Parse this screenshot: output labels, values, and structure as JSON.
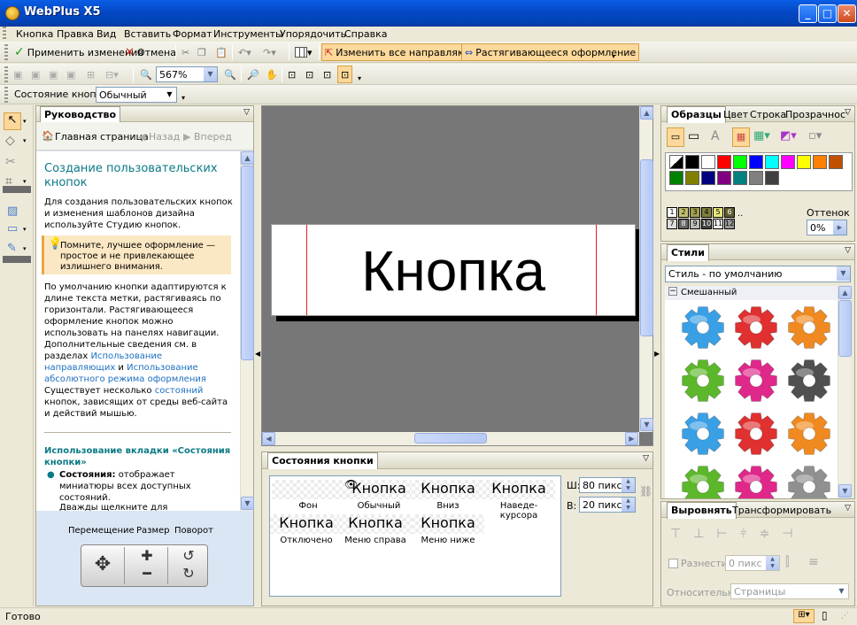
{
  "window": {
    "title": "WebPlus X5"
  },
  "menu": [
    {
      "label": "Кнопка"
    },
    {
      "label": "Правка"
    },
    {
      "label": "Вид"
    },
    {
      "label": "Вставить"
    },
    {
      "label": "Формат"
    },
    {
      "label": "Инструменты"
    },
    {
      "label": "Упорядочить"
    },
    {
      "label": "Справка"
    }
  ],
  "toolbar1": {
    "apply": "Применить изменения",
    "cancel": "Отмена",
    "change_guides": "Изменить все направляющие",
    "stretch": "Растягивающееся оформление"
  },
  "toolbar2": {
    "zoom": "567%"
  },
  "toolbar3": {
    "state_label": "Состояние кнопки:",
    "state_value": "Обычный"
  },
  "guide": {
    "tab": "Руководство",
    "home": "Главная страница",
    "back": "Назад",
    "forward": "Вперед",
    "heading": "Создание пользовательских кнопок",
    "p1": "Для создания пользовательских кнопок и изменения шаблонов дизайна используйте Студию кнопок.",
    "tip": "Помните, лучшее оформление — простое и не привлекающее излишнего внимания.",
    "p2": "По умолчанию кнопки адаптируются к длине текста метки, растягиваясь по горизонтали. Растягивающееся оформление кнопок можно использовать на панелях навигации. Дополнительные сведения см. в разделах",
    "link1": "Использование направляющих",
    "and": "и",
    "link2": "Использование абсолютного режима оформления",
    "p3a": "Существует несколько",
    "p3link": "состояний",
    "p3b": "кнопок, зависящих от среды веб-сайта и действий мышью.",
    "h2": "Использование вкладки «Состояния кнопки»",
    "bullet_b": "Состояния:",
    "bullet": "отображает миниатюры всех доступных состояний.",
    "p4": "Дважды щелкните для",
    "nav_move": "Перемещение",
    "nav_size": "Размер",
    "nav_rotate": "Поворот"
  },
  "canvas": {
    "button_text": "Кнопка"
  },
  "states": {
    "tab": "Состояния кнопки",
    "cells": [
      {
        "text": "",
        "label": "Фон"
      },
      {
        "text": "Кнопка",
        "label": "Обычный"
      },
      {
        "text": "Кнопка",
        "label": "Вниз"
      },
      {
        "text": "Кнопка",
        "label": "Наведе-курсора"
      },
      {
        "text": "Кнопка",
        "label": "Отключено"
      },
      {
        "text": "Кнопка",
        "label": "Меню справа"
      },
      {
        "text": "Кнопка",
        "label": "Меню ниже"
      }
    ],
    "w_label": "Ш:",
    "w_value": "80 пикс",
    "h_label": "В:",
    "h_value": "20 пикс"
  },
  "swatches": {
    "tabs": [
      "Образцы",
      "Цвет",
      "Строка",
      "Прозрачност"
    ],
    "colors": [
      "#ffffff",
      "#000000",
      "#ffffff",
      "#ff0000",
      "#00ff00",
      "#0000ff",
      "#00ffff",
      "#ff00ff",
      "#ffff00",
      "#ff8000",
      "#c05000",
      "#008000",
      "#808000",
      "#000080",
      "#800080",
      "#008080",
      "#808080",
      "#404040"
    ],
    "tint_label": "Оттенок",
    "tint_value": "0%",
    "numbers": [
      "1",
      "2",
      "3",
      "4",
      "5",
      "6",
      "7",
      "8",
      "9",
      "10",
      "11",
      "12"
    ],
    "more": ".."
  },
  "styles": {
    "tab": "Стили",
    "select": "Стиль - по умолчанию",
    "group": "Смешанный",
    "gear_colors": [
      "#3aa0e6",
      "#e03030",
      "#f08a20",
      "#5cb82a",
      "#e0288a",
      "#505050",
      "#3aa0e6",
      "#e03030",
      "#f08a20",
      "#5cb82a",
      "#e0288a",
      "#909090"
    ]
  },
  "align": {
    "tab1": "Выровнять",
    "tab2": "Трансформировать",
    "spread": "Разнести",
    "spread_value": "0 пикс",
    "relative": "Относительно:",
    "relative_value": "Страницы"
  },
  "status": {
    "text": "Готово"
  }
}
